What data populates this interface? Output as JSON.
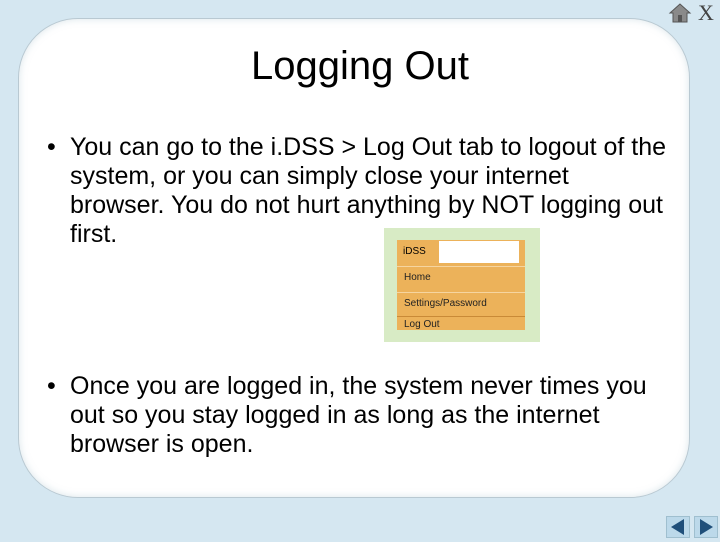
{
  "slide": {
    "title": "Logging Out",
    "bullets": [
      {
        "marker": "•",
        "text": "You can go to the i.DSS > Log Out tab to logout of the system, or you can simply close your internet browser.  You do not hurt anything by NOT logging out first."
      },
      {
        "marker": "•",
        "text": "Once you are logged in, the system never times you out so you stay logged in as long as the internet browser is open."
      }
    ]
  },
  "menu_screenshot": {
    "header": "iDSS",
    "items": [
      "Home",
      "Settings/Password",
      "Log Out"
    ],
    "colors": {
      "menu_bg": "#ecb25a",
      "frame_bg": "#d8ebc5"
    }
  },
  "controls": {
    "close_label": "X",
    "icons": [
      "home-icon",
      "prev-arrow-icon",
      "next-arrow-icon"
    ]
  },
  "colors": {
    "background": "#d5e7f1",
    "panel": "#ffffff",
    "nav_arrow": "#1f4f7a"
  }
}
